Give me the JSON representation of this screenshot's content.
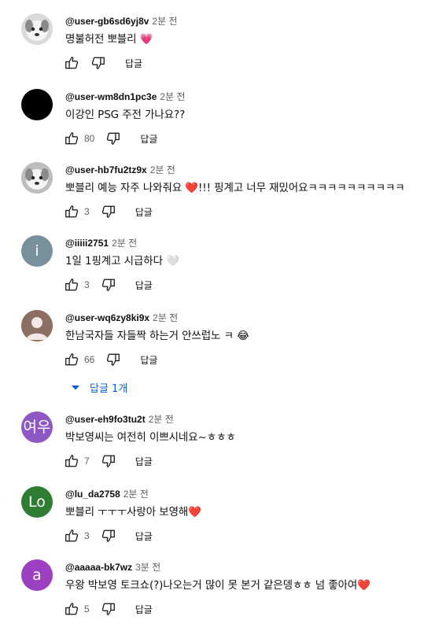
{
  "reply_label": "답글",
  "comments": [
    {
      "author": "@user-gb6sd6yj8v",
      "time": "2분 전",
      "text": "명불허전 뽀블리 💗",
      "likes": "",
      "avatar": {
        "type": "photo",
        "bg": "#d9d9d9"
      }
    },
    {
      "author": "@user-wm8dn1pc3e",
      "time": "2분 전",
      "text": "이강인 PSG 주전 가나요??",
      "likes": "80",
      "avatar": {
        "type": "solid",
        "bg": "#000000"
      }
    },
    {
      "author": "@user-hb7fu2tz9x",
      "time": "2분 전",
      "text": "뽀블리 예능 자주 나와줘요 ❤️!!! 핑계고 너무 재밌어요ㅋㅋㅋㅋㅋㅋㅋㅋㅋㅋ",
      "likes": "3",
      "avatar": {
        "type": "photo",
        "bg": "#bdbdbd"
      }
    },
    {
      "author": "@iiiii2751",
      "time": "2분 전",
      "text": "1일 1핑계고 시급하다 🤍",
      "likes": "3",
      "avatar": {
        "type": "letter",
        "letter": "i",
        "bg": "#78909c"
      }
    },
    {
      "author": "@user-wq6zy8ki9x",
      "time": "2분 전",
      "text": "한남국자들 자들짝 하는거 안쓰럽노 ㅋ 😂",
      "likes": "66",
      "avatar": {
        "type": "default",
        "bg": "#8d6e63"
      }
    },
    {
      "author": "@user-eh9fo3tu2t",
      "time": "2분 전",
      "text": "박보영씨는 여전히 이쁘시네요~ㅎㅎㅎ",
      "likes": "7",
      "avatar": {
        "type": "letter",
        "letter": "여우",
        "bg": "#8e58c4"
      }
    },
    {
      "author": "@lu_da2758",
      "time": "2분 전",
      "text": "뽀블리 ㅜㅜㅜ사랑아 보영해❤️",
      "likes": "3",
      "avatar": {
        "type": "letter",
        "letter": "Lo",
        "bg": "#2e7d32"
      }
    },
    {
      "author": "@aaaaa-bk7wz",
      "time": "3분 전",
      "text": "우왕 박보영 토크쇼(?)나오는거 많이 못 본거 같은뎅ㅎㅎ 넘 좋아여❤️",
      "likes": "5",
      "avatar": {
        "type": "letter",
        "letter": "a",
        "bg": "#9c3fc0"
      }
    }
  ],
  "replies_toggle": {
    "label": "답글 1개"
  },
  "colors": {
    "link": "#065fd4",
    "meta": "#606060"
  }
}
